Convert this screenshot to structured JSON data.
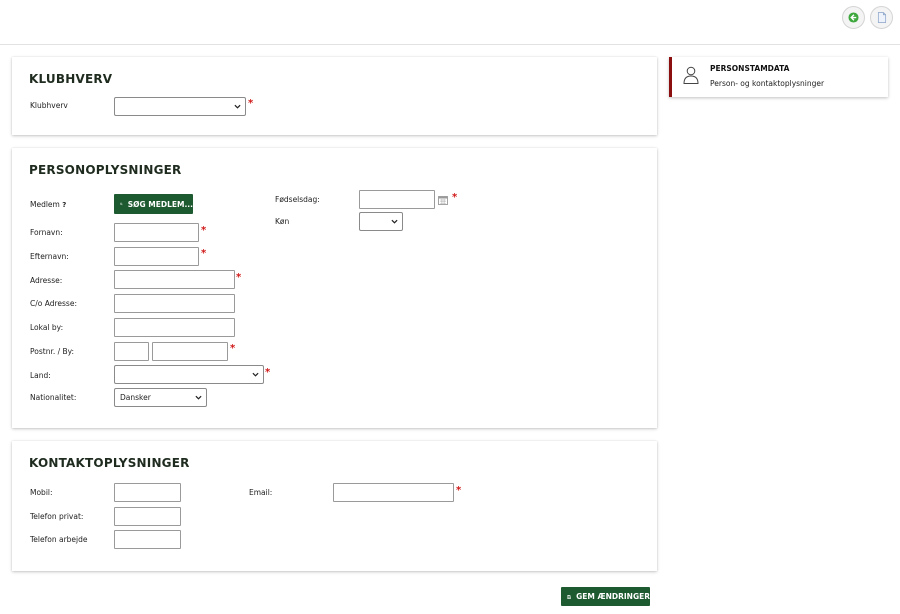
{
  "toolbar": {
    "back_icon": "arrow-left-circle-icon",
    "doc_icon": "document-icon"
  },
  "klubhverv": {
    "title": "KLUBHVERV",
    "field_label": "Klubhverv",
    "field_value": ""
  },
  "person": {
    "title": "PERSONOPLYSNINGER",
    "medlem_label": "Medlem",
    "medlem_help": "?",
    "search_button": "SØG MEDLEM...",
    "fornavn_label": "Fornavn:",
    "efternavn_label": "Efternavn:",
    "adresse_label": "Adresse:",
    "co_adresse_label": "C/o Adresse:",
    "lokal_by_label": "Lokal by:",
    "postnr_label": "Postnr. / By:",
    "land_label": "Land:",
    "land_value": "",
    "nationalitet_label": "Nationalitet:",
    "nationalitet_value": "Dansker",
    "fodselsdag_label": "Fødselsdag:",
    "kon_label": "Køn",
    "kon_value": ""
  },
  "contact": {
    "title": "KONTAKTOPLYSNINGER",
    "mobil_label": "Mobil:",
    "telefon_privat_label": "Telefon privat:",
    "telefon_arbejde_label": "Telefon arbejde",
    "email_label": "Email:"
  },
  "required_mark": "*",
  "save_button": "GEM ÆNDRINGER",
  "side_panel": {
    "title": "PERSONSTAMDATA",
    "subtitle": "Person- og kontaktoplysninger"
  },
  "colors": {
    "primary_green": "#1d5a30",
    "accent_red": "#8b0f0f",
    "required_red": "#d01818"
  }
}
